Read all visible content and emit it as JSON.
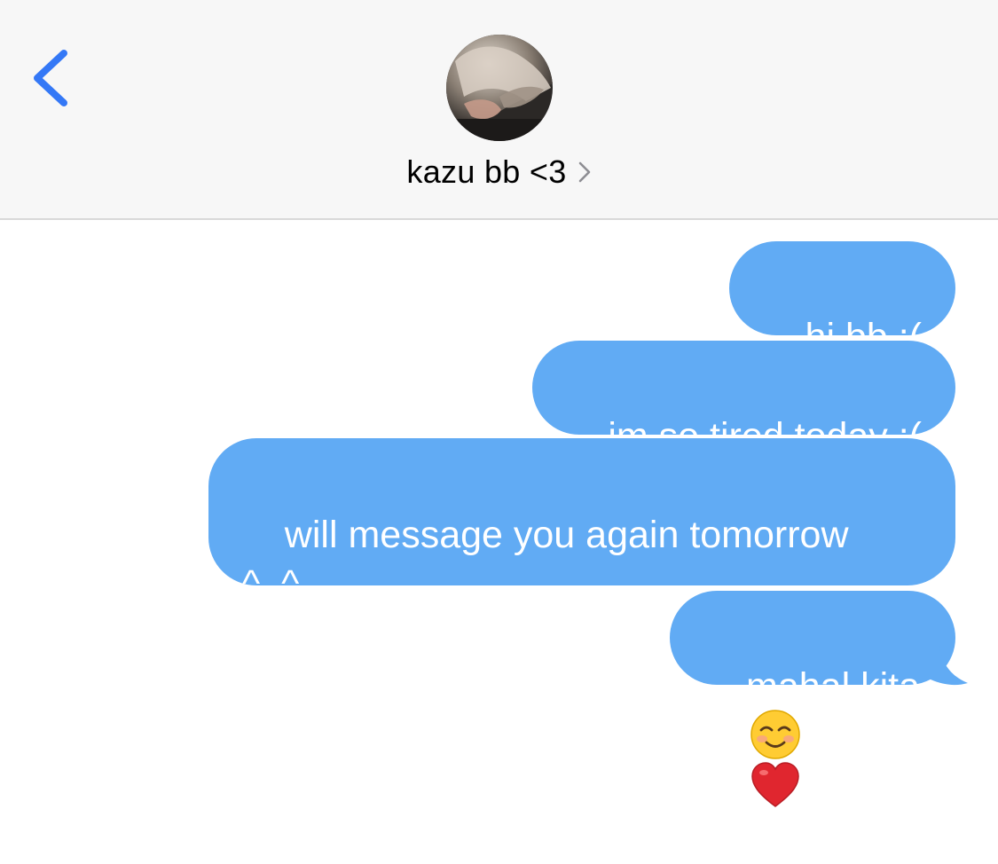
{
  "header": {
    "contact_name": "kazu bb <3",
    "back_icon": "chevron-left-icon",
    "detail_icon": "chevron-right-icon",
    "accent_color": "#3478f6"
  },
  "messages": [
    {
      "text": "hi bb :(",
      "direction": "outgoing"
    },
    {
      "text": "im so tired today :(",
      "direction": "outgoing"
    },
    {
      "text": "will message you again tomorrow\n^_^",
      "direction": "outgoing"
    },
    {
      "text": "mahal kita",
      "direction": "outgoing",
      "emojis": [
        "smiling-face-icon",
        "red-heart-icon"
      ]
    }
  ],
  "colors": {
    "bubble": "#61abf4",
    "header_bg": "#f7f7f7"
  }
}
